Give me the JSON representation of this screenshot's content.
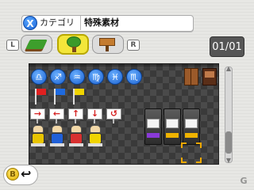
{
  "header": {
    "category_button": "X",
    "category_label": "カテゴリ",
    "category_value": "特殊素材"
  },
  "tabs": {
    "left_shoulder": "L",
    "right_shoulder": "R",
    "items": [
      {
        "icon": "ground-block-icon",
        "selected": false
      },
      {
        "icon": "tree-icon",
        "selected": true
      },
      {
        "icon": "signpost-icon",
        "selected": false
      }
    ]
  },
  "pager": {
    "text": "01/01"
  },
  "grid": {
    "zodiac_symbols": [
      "♎",
      "♐",
      "♒",
      "♍",
      "♓",
      "♏"
    ],
    "flag_colors": [
      "#e02020",
      "#1e6ae0",
      "#f0d400"
    ],
    "arrow_symbols": [
      "→",
      "←",
      "↑",
      "↓",
      "↺"
    ],
    "figure_colors": [
      "#e8c400",
      "#2060d8",
      "#d83030",
      "#f0d400"
    ],
    "slot_panel_colors": [
      "#8a3ad8",
      "#f0b400",
      "#f0b400"
    ]
  },
  "footer": {
    "b_button": "B",
    "back_icon": "↩"
  },
  "colors": {
    "accent": "#f0a800",
    "selected_tab": "#f3e63a"
  }
}
